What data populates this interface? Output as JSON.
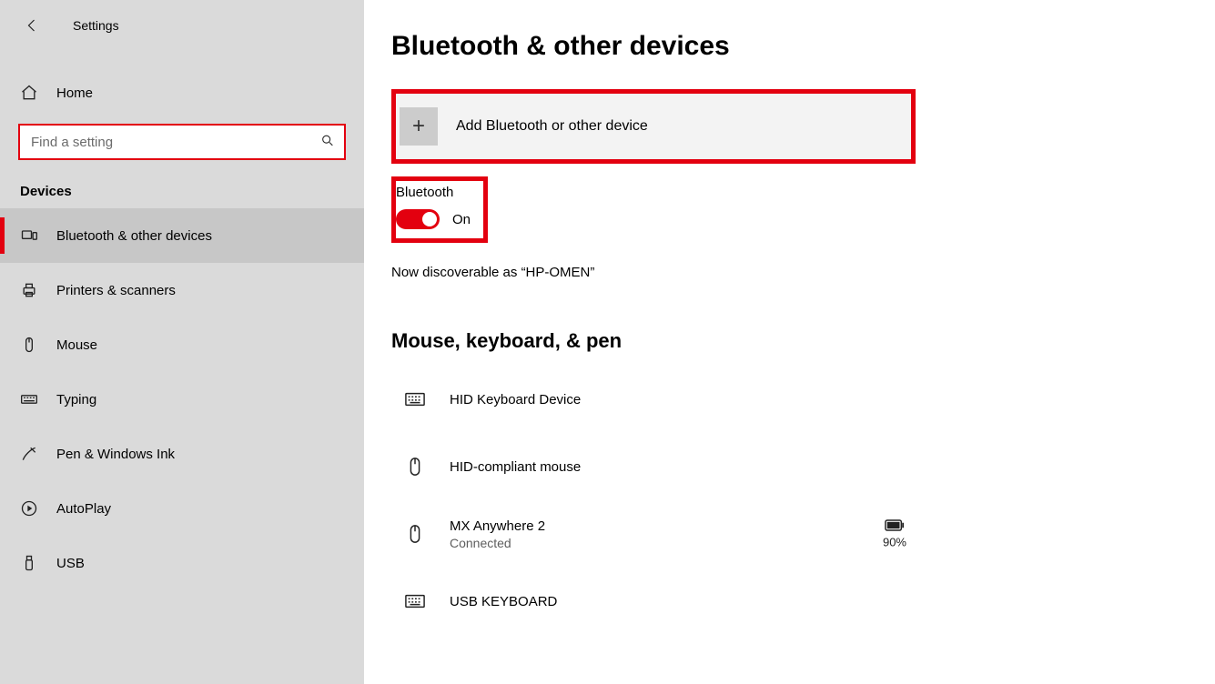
{
  "header": {
    "title": "Settings"
  },
  "sidebar": {
    "home_label": "Home",
    "search_placeholder": "Find a setting",
    "category_label": "Devices",
    "items": [
      {
        "label": "Bluetooth & other devices",
        "icon": "bluetooth"
      },
      {
        "label": "Printers & scanners",
        "icon": "printer"
      },
      {
        "label": "Mouse",
        "icon": "mouse"
      },
      {
        "label": "Typing",
        "icon": "keyboard"
      },
      {
        "label": "Pen & Windows Ink",
        "icon": "pen"
      },
      {
        "label": "AutoPlay",
        "icon": "autoplay"
      },
      {
        "label": "USB",
        "icon": "usb"
      }
    ]
  },
  "main": {
    "page_title": "Bluetooth & other devices",
    "add_device_label": "Add Bluetooth or other device",
    "bluetooth": {
      "label": "Bluetooth",
      "state_label": "On",
      "state": true
    },
    "discoverable_text": "Now discoverable as “HP-OMEN”",
    "section_heading": "Mouse, keyboard, & pen",
    "devices": [
      {
        "name": "HID Keyboard Device",
        "sub": "",
        "icon": "keyboard",
        "battery": null
      },
      {
        "name": "HID-compliant mouse",
        "sub": "",
        "icon": "mouse",
        "battery": null
      },
      {
        "name": "MX Anywhere 2",
        "sub": "Connected",
        "icon": "mouse",
        "battery": "90%"
      },
      {
        "name": "USB KEYBOARD",
        "sub": "",
        "icon": "keyboard",
        "battery": null
      }
    ]
  }
}
